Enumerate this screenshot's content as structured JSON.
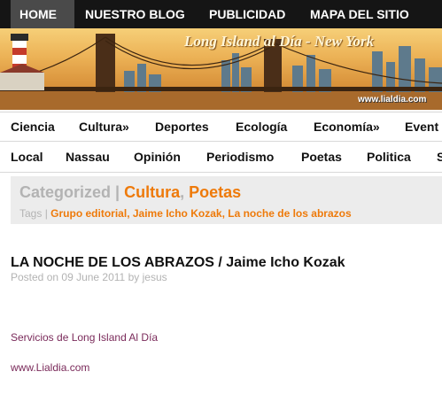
{
  "topnav": {
    "items": [
      {
        "label": "HOME",
        "active": true
      },
      {
        "label": "NUESTRO BLOG",
        "active": false
      },
      {
        "label": "PUBLICIDAD",
        "active": false
      },
      {
        "label": "MAPA DEL SITIO",
        "active": false
      }
    ]
  },
  "banner": {
    "title": "Long Island al Día - New York",
    "url": "www.lialdia.com"
  },
  "categories_row1": [
    "Ciencia",
    "Cultura»",
    "Deportes",
    "Ecología",
    "Economía»",
    "Event"
  ],
  "categories_row2": [
    "Local",
    "Nassau",
    "Opinión",
    "Periodismo",
    "Poetas",
    "Politica",
    "S"
  ],
  "category_box": {
    "label": "Categorized",
    "separator": "|",
    "categories": [
      "Cultura",
      "Poetas"
    ],
    "tags_label": "Tags",
    "tags": [
      "Grupo editorial",
      "Jaime Icho Kozak",
      "La noche de los abrazos"
    ]
  },
  "post": {
    "title": "LA NOCHE DE LOS ABRAZOS / Jaime Icho Kozak",
    "posted_on_label": "Posted on",
    "date": "09 June 2011",
    "by_label": "by",
    "author": "jesus",
    "services_text": "Servicios de Long Island Al Día",
    "link_text": "www.Lialdia.com"
  },
  "colors": {
    "nav_bg": "#151515",
    "nav_active_bg": "#4a4a4a",
    "accent_orange": "#ee7a0a",
    "muted_grey": "#b3b3b3",
    "link_purple": "#7a2a5a"
  }
}
